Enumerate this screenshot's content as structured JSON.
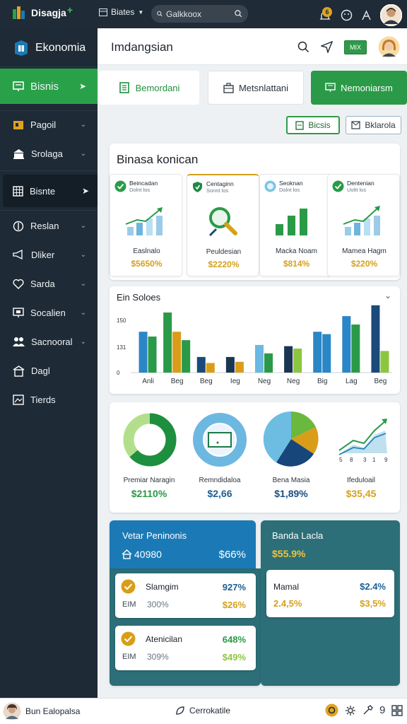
{
  "app": {
    "name": "Disagja"
  },
  "topbar": {
    "menu_label": "Biates",
    "search_placeholder": "Galkkoox",
    "notification_count": "6"
  },
  "sidebar": {
    "title": "Ekonomia",
    "items": [
      {
        "label": "Bisnis",
        "icon": "chart-icon",
        "state": "active"
      },
      {
        "label": "Pagoil",
        "icon": "folder-icon"
      },
      {
        "label": "Srolaga",
        "icon": "bank-icon"
      },
      {
        "label": "Bisnte",
        "icon": "grid-icon",
        "state": "selected"
      },
      {
        "label": "Reslan",
        "icon": "compass-icon"
      },
      {
        "label": "Dliker",
        "icon": "megaphone-icon"
      },
      {
        "label": "Sarda",
        "icon": "heart-icon"
      },
      {
        "label": "Socalien",
        "icon": "presentation-icon"
      },
      {
        "label": "Sacnooral",
        "icon": "users-icon"
      },
      {
        "label": "Dagl",
        "icon": "building-icon"
      },
      {
        "label": "Tierds",
        "icon": "picture-icon"
      }
    ]
  },
  "header": {
    "title": "Imdangsian",
    "badge": "MIX"
  },
  "tabs": [
    {
      "label": "Bemordani",
      "icon": "document-icon"
    },
    {
      "label": "Metsnlattani",
      "icon": "briefcase-icon"
    },
    {
      "label": "Nemoniarsm",
      "icon": "monitor-icon"
    }
  ],
  "pills": [
    {
      "label": "Bicsis",
      "icon": "doc-icon"
    },
    {
      "label": "Bklarola",
      "icon": "mail-icon"
    }
  ],
  "business": {
    "title": "Binasa konican",
    "cards": [
      {
        "head": "Beincadan",
        "sub": "Dolnt los",
        "label": "Easlnalo",
        "value": "$5650%",
        "icon": "check-circle-icon"
      },
      {
        "head": "Centaginn",
        "sub": "Sonnt los",
        "label": "Peuldesian",
        "value": "$2220%",
        "icon": "shield-check-icon"
      },
      {
        "head": "Seoknan",
        "sub": "Dolnt los",
        "label": "Macka Noam",
        "value": "$814%",
        "icon": "globe-icon"
      },
      {
        "head": "Dentenian",
        "sub": "Uoltt los",
        "label": "Mamea Hagm",
        "value": "$220%",
        "icon": "check-circle-icon"
      }
    ]
  },
  "sales": {
    "title": "Ein Soloes"
  },
  "chart_data": {
    "type": "bar",
    "categories": [
      "Anli",
      "Beg",
      "Beg",
      "Ieg",
      "Neg",
      "Neg",
      "Big",
      "Lag",
      "Beg"
    ],
    "series": [
      {
        "values": [
          0,
          0,
          0,
          0,
          240,
          280,
          350,
          470,
          560
        ],
        "color": "#1b7ab5"
      },
      {
        "values": [
          360,
          500,
          150,
          170,
          0,
          0,
          0,
          0,
          0
        ],
        "color": "#1e7ab8"
      },
      {
        "values": [
          0,
          0,
          0,
          0,
          0,
          0,
          0,
          0,
          0
        ],
        "color": "#2a9a48"
      }
    ],
    "bars": [
      [
        340,
        300
      ],
      [
        500,
        340,
        270
      ],
      [
        130,
        80
      ],
      [
        130,
        90
      ],
      [
        230,
        160
      ],
      [
        220,
        200
      ],
      [
        340,
        320,
        0
      ],
      [
        470,
        400
      ],
      [
        560,
        180
      ]
    ],
    "yticks": [
      "150",
      "131",
      "0"
    ]
  },
  "donuts": [
    {
      "label": "Premiar Naragin",
      "value": "$2110%"
    },
    {
      "label": "Remndidaloa",
      "value": "$2,66"
    },
    {
      "label": "Bena Masia",
      "value": "$1,89%"
    },
    {
      "label": "Ifeduloail",
      "value": "$35,45",
      "ticks": [
        "5",
        "8",
        "3",
        "1",
        "9"
      ]
    }
  ],
  "vetar": {
    "title": "Vetar Peninonis",
    "left_value": "40980",
    "right_value": "$66%",
    "rows": [
      {
        "name": "Slamgim",
        "pct": "927%",
        "sub": "EIM",
        "sub_pct": "300%",
        "amt": "$26%"
      },
      {
        "name": "Atenicilan",
        "pct": "648%",
        "sub": "EIM",
        "sub_pct": "309%",
        "amt": "$49%"
      }
    ]
  },
  "banda": {
    "title": "Banda Lacla",
    "value": "$55.9%",
    "card": {
      "name": "Mamal",
      "value": "$2.4%",
      "sub_left": "2.4,5%",
      "sub_right": "$3,5%"
    }
  },
  "footer": {
    "user": "Bun Ealopalsa",
    "center": "Cerrokatile"
  }
}
